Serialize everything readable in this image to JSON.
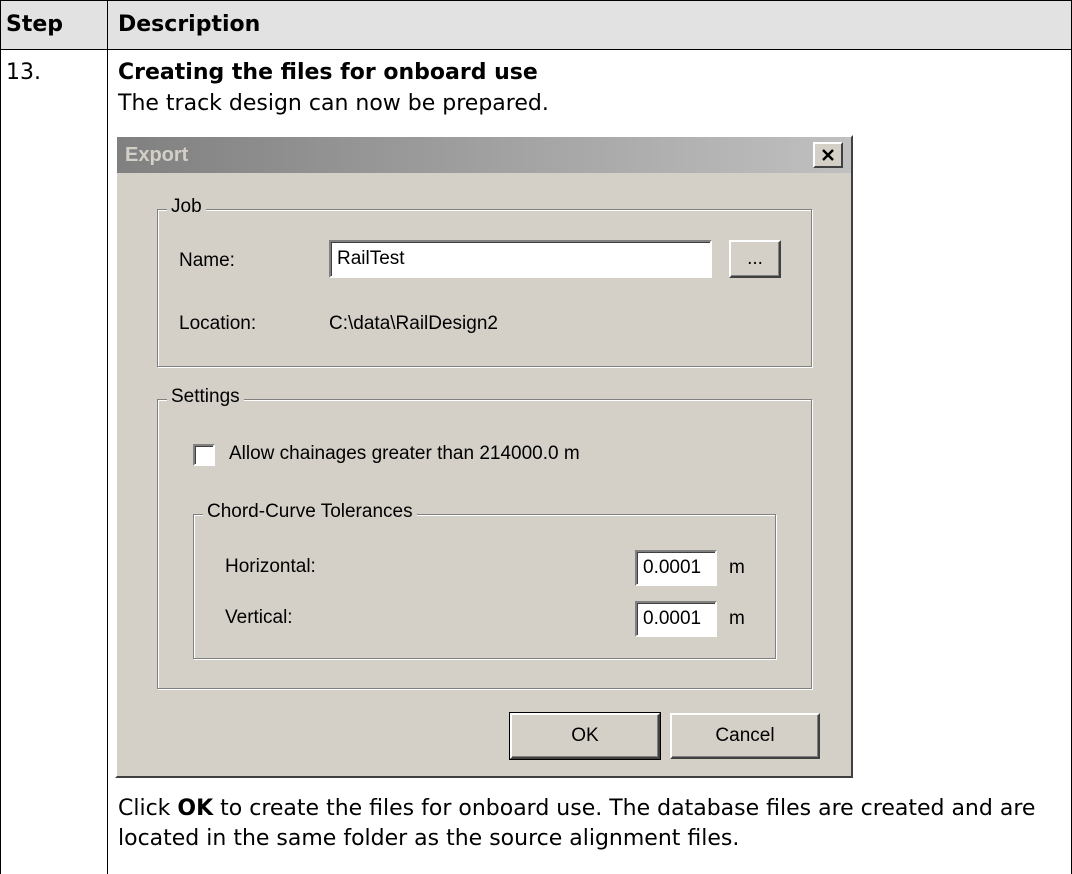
{
  "table": {
    "header_step": "Step",
    "header_description": "Description",
    "step_number": "13.",
    "step_title": "Creating the files for onboard use",
    "step_intro": "The track design can now be prepared.",
    "footer_pre": "Click ",
    "footer_bold": "OK",
    "footer_post": " to create the files for onboard use. The database files are created and are located in the same folder as the source alignment files."
  },
  "dialog": {
    "title": "Export",
    "close_icon": "close-icon",
    "job_group": {
      "legend": "Job",
      "name_label": "Name:",
      "name_value": "RailTest",
      "browse_label": "...",
      "location_label": "Location:",
      "location_value": "C:\\data\\RailDesign2"
    },
    "settings_group": {
      "legend": "Settings",
      "allow_chainages_label": "Allow chainages greater than 214000.0 m",
      "allow_chainages_checked": false,
      "tolerances": {
        "legend": "Chord-Curve Tolerances",
        "horizontal_label": "Horizontal:",
        "horizontal_value": "0.0001",
        "horizontal_unit": "m",
        "vertical_label": "Vertical:",
        "vertical_value": "0.0001",
        "vertical_unit": "m"
      }
    },
    "ok_label": "OK",
    "cancel_label": "Cancel"
  },
  "colors": {
    "header_bg": "#e2e2e2",
    "dialog_bg": "#d4d0c8",
    "titlebar_start": "#808080",
    "titlebar_end": "#c0c0c0"
  }
}
